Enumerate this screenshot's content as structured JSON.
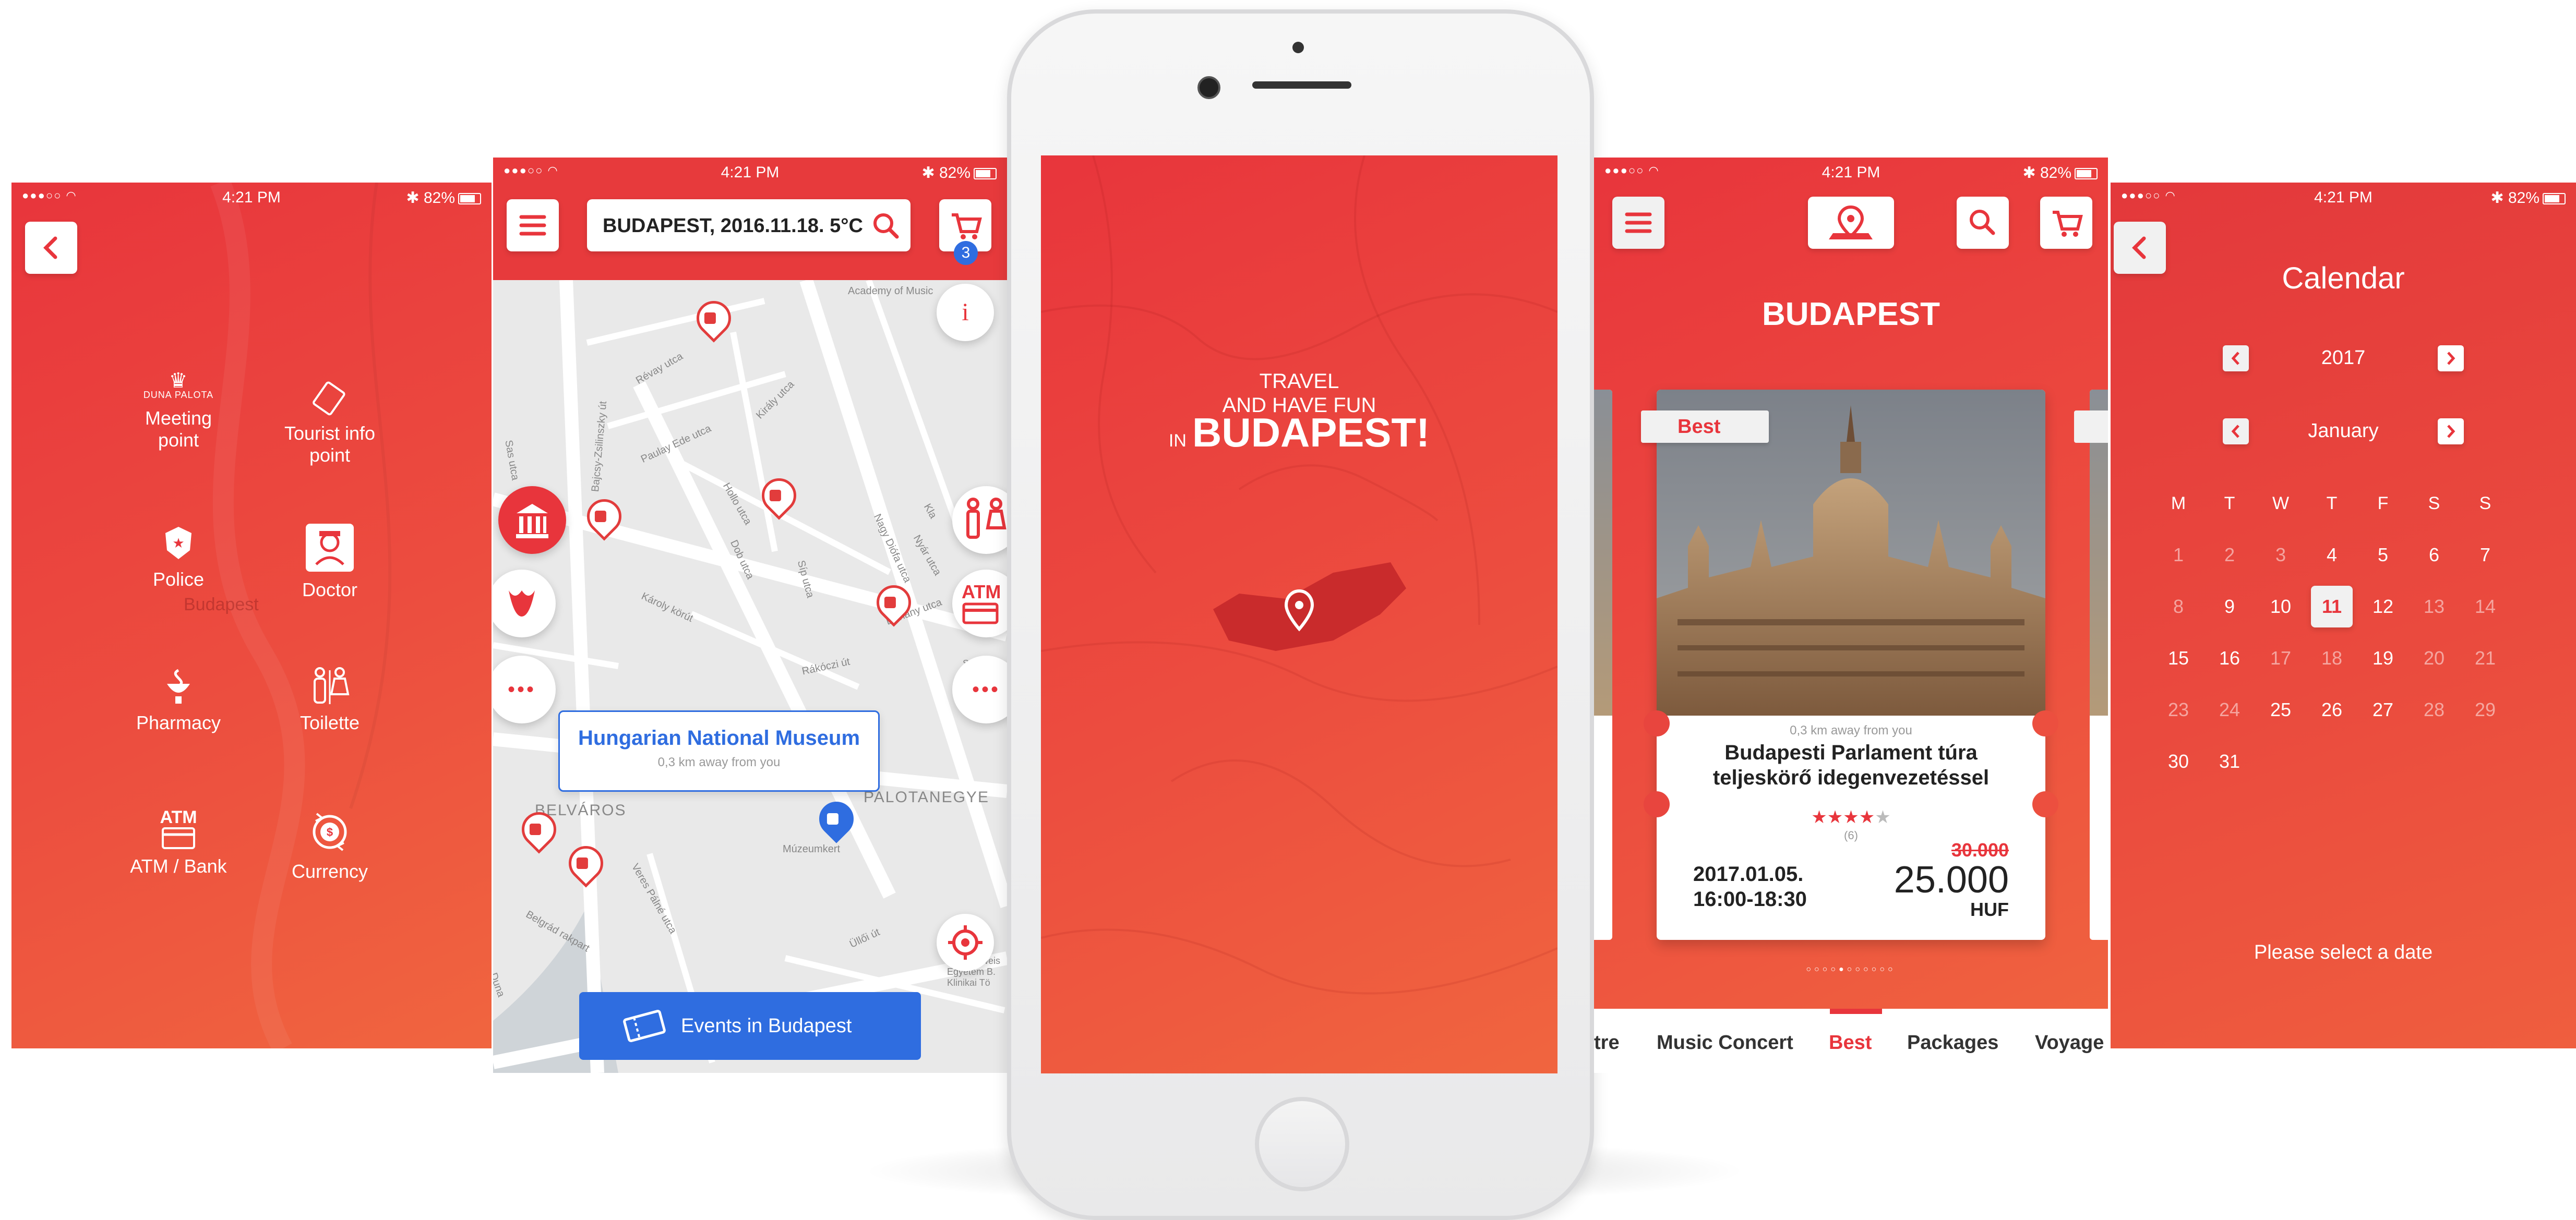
{
  "status": {
    "time": "4:21 PM",
    "battery": "82%"
  },
  "screen1": {
    "watermark": "Budapest",
    "services": [
      {
        "label": "Meeting\npoint",
        "logo_text": "DUNA PALOTA"
      },
      {
        "label": "Tourist info\npoint"
      },
      {
        "label": "Police"
      },
      {
        "label": "Doctor"
      },
      {
        "label": "Pharmacy"
      },
      {
        "label": "Toilette"
      },
      {
        "label": "ATM / Bank",
        "icon_text": "ATM"
      },
      {
        "label": "Currency"
      }
    ]
  },
  "screen2": {
    "search_value": "BUDAPEST, 2016.11.18. 5°C",
    "cart_count": "3",
    "info_glyph": "i",
    "more_glyph": "•••",
    "map_labels": [
      "Academy of Music",
      "Révay utca",
      "Király utca",
      "Paulay Ede utca",
      "Bajcsy-Zsilinszky út",
      "Sas utca",
      "Hollo utca",
      "Dob utca",
      "Síp utca",
      "Nagy Diófa utca",
      "Károly körút",
      "Dohány utca",
      "Rákóczi út",
      "BELVÁROS",
      "PALOTANEGYE",
      "Múzeumkert",
      "Veres Pálné utca",
      "Belgrád rakpart",
      "Üllői út",
      "Szent R",
      "Semmelweis Egyetem B. Klinikai Tö",
      "Duna",
      "Kla",
      "Nyár utca"
    ],
    "atm_text": "ATM",
    "popup_title": "Hungarian National Museum",
    "popup_sub": "0,3 km away from you",
    "events_button": "Events in Budapest"
  },
  "screen3": {
    "line1": "TRAVEL",
    "line2": "AND HAVE FUN",
    "line3_small": "IN",
    "line3_big": "BUDAPEST!"
  },
  "screen4": {
    "title": "BUDAPEST",
    "badge": "Best",
    "distance": "0,3 km away from you",
    "event_title_1": "Budapesti Parlament túra",
    "event_title_2": "teljeskörő idegenvezetéssel",
    "rating_count": "(6)",
    "rating": 4,
    "date": "2017.01.05.",
    "time": "16:00-18:30",
    "old_price": "30.000",
    "price": "25.000",
    "currency": "HUF",
    "dots": "○○○○●○○○○○○",
    "tabs": [
      "tre",
      "Music Concert",
      "Best",
      "Packages",
      "Voyage"
    ],
    "active_tab": "Best"
  },
  "screen5": {
    "title": "Calendar",
    "year": "2017",
    "month": "January",
    "weekdays": [
      "M",
      "T",
      "W",
      "T",
      "F",
      "S",
      "S"
    ],
    "days": [
      [
        "1",
        "2",
        "3",
        "4",
        "5",
        "6",
        "7"
      ],
      [
        "8",
        "9",
        "10",
        "11",
        "12",
        "13",
        "14"
      ],
      [
        "15",
        "16",
        "17",
        "18",
        "19",
        "20",
        "21"
      ],
      [
        "23",
        "24",
        "25",
        "26",
        "27",
        "28",
        "29"
      ],
      [
        "30",
        "31",
        "",
        "",
        "",
        "",
        ""
      ]
    ],
    "selected": "11",
    "prompt": "Please select a date"
  },
  "colors": {
    "brand_red": "#e8353c",
    "accent_blue": "#2f6de0",
    "white": "#ffffff"
  }
}
